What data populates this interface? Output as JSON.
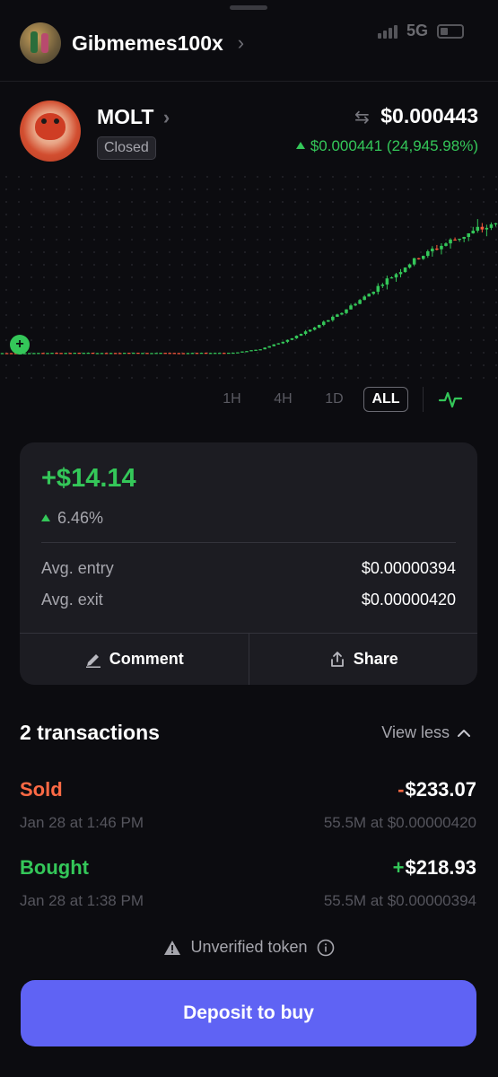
{
  "status_bar": {
    "network": "5G"
  },
  "header": {
    "wallet_name": "Gibmemes100x"
  },
  "token": {
    "name": "MOLT",
    "status_badge": "Closed",
    "price": "$0.000443",
    "change": "$0.000441 (24,945.98%)",
    "change_color": "#34c759"
  },
  "chart_data": {
    "type": "candlestick",
    "title": "",
    "xlabel": "",
    "ylabel": "",
    "grid": true,
    "note_trend": [
      1.5e-06,
      1.5e-06,
      1.6e-06,
      1.6e-06,
      1.5e-06,
      1.6e-06,
      1.6e-06,
      1.5e-06,
      1.6e-06,
      1.7e-06,
      4e-06,
      1.2e-05,
      3e-05,
      6e-05,
      0.00011,
      0.00018,
      0.00026,
      0.00033,
      0.00039,
      0.000443
    ],
    "up_color": "#34c759",
    "down_color": "#ff5a3c",
    "timeframes": [
      "1H",
      "4H",
      "1D",
      "ALL"
    ],
    "selected_timeframe": "ALL"
  },
  "position": {
    "pnl": "+$14.14",
    "pnl_pct": "6.46%",
    "avg_entry_label": "Avg. entry",
    "avg_entry": "$0.00000394",
    "avg_exit_label": "Avg. exit",
    "avg_exit": "$0.00000420",
    "comment_label": "Comment",
    "share_label": "Share"
  },
  "transactions": {
    "title": "2 transactions",
    "toggle_label": "View less",
    "items": [
      {
        "type": "Sold",
        "sign": "-",
        "amount": "$233.07",
        "date": "Jan 28 at 1:46 PM",
        "detail": "55.5M at $0.00000420"
      },
      {
        "type": "Bought",
        "sign": "+",
        "amount": "$218.93",
        "date": "Jan 28 at 1:38 PM",
        "detail": "55.5M at $0.00000394"
      }
    ]
  },
  "warning": {
    "text": "Unverified token"
  },
  "cta": {
    "label": "Deposit to buy",
    "color": "#5f63f4"
  }
}
